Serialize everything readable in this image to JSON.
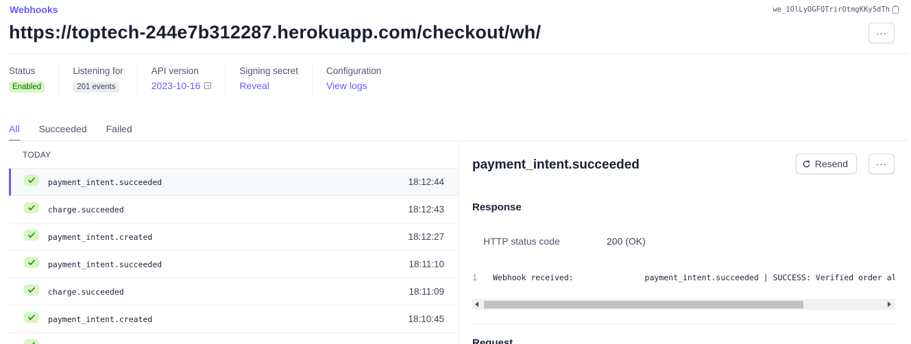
{
  "breadcrumb": "Webhooks",
  "endpoint_id": "we_1OlLyOGFQTrirOtmgKKy5dTh",
  "page_title": "https://toptech-244e7b312287.herokuapp.com/checkout/wh/",
  "more_label": "···",
  "meta": {
    "status": {
      "label": "Status",
      "value": "Enabled"
    },
    "listening": {
      "label": "Listening for",
      "value": "201 events"
    },
    "api_version": {
      "label": "API version",
      "value": "2023-10-16"
    },
    "signing_secret": {
      "label": "Signing secret",
      "value": "Reveal"
    },
    "configuration": {
      "label": "Configuration",
      "value": "View logs"
    }
  },
  "tabs": [
    "All",
    "Succeeded",
    "Failed"
  ],
  "list": {
    "group_header": "TODAY",
    "events": [
      {
        "name": "payment_intent.succeeded",
        "time": "18:12:44"
      },
      {
        "name": "charge.succeeded",
        "time": "18:12:43"
      },
      {
        "name": "payment_intent.created",
        "time": "18:12:27"
      },
      {
        "name": "payment_intent.succeeded",
        "time": "18:11:10"
      },
      {
        "name": "charge.succeeded",
        "time": "18:11:09"
      },
      {
        "name": "payment_intent.created",
        "time": "18:10:45"
      },
      {
        "name": "",
        "time": ""
      }
    ]
  },
  "detail": {
    "title": "payment_intent.succeeded",
    "resend_label": "Resend",
    "response_heading": "Response",
    "http_status_label": "HTTP status code",
    "http_status_value": "200 (OK)",
    "response_line_number": "1",
    "response_body": "Webhook received:               payment_intent.succeeded | SUCCESS: Verified order already in database",
    "request_heading": "Request"
  },
  "colors": {
    "accent": "#635bff",
    "success_bg": "#d7f7c2",
    "success_fg": "#05690d"
  }
}
